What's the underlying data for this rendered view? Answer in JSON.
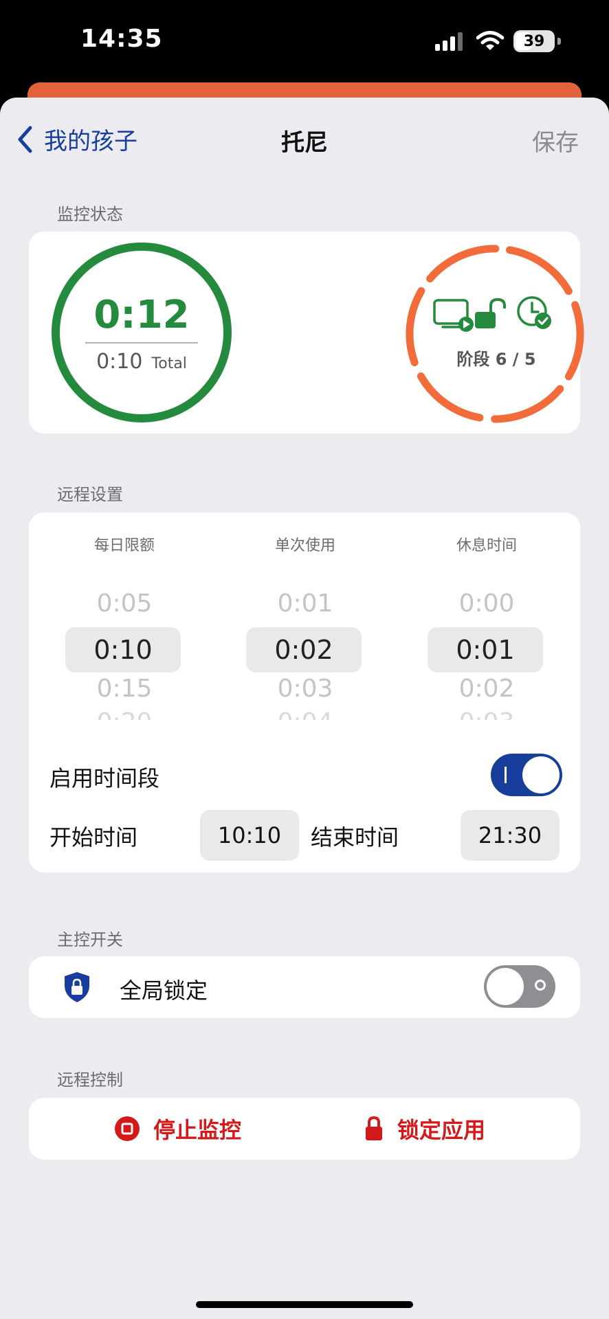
{
  "status_bar": {
    "time": "14:35",
    "battery": "39"
  },
  "nav": {
    "back_label": "我的孩子",
    "title": "托尼",
    "save_label": "保存"
  },
  "monitor": {
    "section_title": "监控状态",
    "time_used": "0:12",
    "time_total": "0:10",
    "total_label": "Total",
    "phase_text": "阶段 6 / 5",
    "colors": {
      "ring": "#248a3d",
      "phase_ring": "#f26b3a"
    },
    "icons": [
      "screen-play-icon",
      "unlocked-icon",
      "clock-check-icon"
    ]
  },
  "remote_settings": {
    "section_title": "远程设置",
    "pickers": [
      {
        "label": "每日限额",
        "above": "0:05",
        "selected": "0:10",
        "below": "0:15"
      },
      {
        "label": "单次使用",
        "above": "0:01",
        "selected": "0:02",
        "below": "0:03"
      },
      {
        "label": "休息时间",
        "above": "0:00",
        "selected": "0:01",
        "below": "0:02"
      }
    ],
    "enable_period_label": "启用时间段",
    "enable_period_on": true,
    "start_label": "开始时间",
    "start_time": "10:10",
    "end_label": "结束时间",
    "end_time": "21:30"
  },
  "master_switch": {
    "section_title": "主控开关",
    "global_lock_label": "全局锁定",
    "global_lock_on": false,
    "shield_color": "#173e9a"
  },
  "remote_control": {
    "section_title": "远程控制",
    "stop_label": "停止监控",
    "lock_label": "锁定应用",
    "color": "#d21a1a"
  }
}
